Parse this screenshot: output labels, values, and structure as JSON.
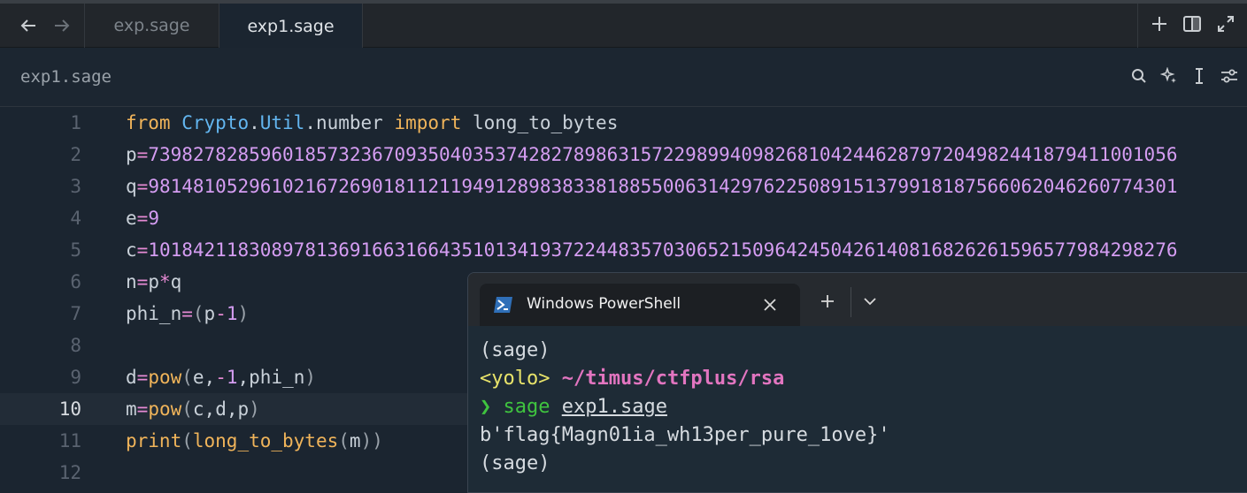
{
  "tabs": [
    {
      "label": "exp.sage"
    },
    {
      "label": "exp1.sage"
    }
  ],
  "breadcrumb": "exp1.sage",
  "icons": {
    "back": "arrow-left-icon",
    "forward": "arrow-right-icon",
    "new_tab": "plus-icon",
    "split": "split-pane-icon",
    "fullscreen": "maximize-icon",
    "search": "search-icon",
    "ai": "sparkle-icon",
    "cursor": "text-cursor-icon",
    "settings": "sliders-icon"
  },
  "code": {
    "current_line": 10,
    "lines": [
      {
        "n": "1"
      },
      {
        "n": "2",
        "p_value": "73982782859601857323670935040353742827898631572298994098268104244628797204982441879411001056"
      },
      {
        "n": "3",
        "q_value": "98148105296102167269018112119491289838338188550063142976225089151379918187566062046260774301"
      },
      {
        "n": "4",
        "e_value": "9"
      },
      {
        "n": "5",
        "c_value": "10184211830897813691663166435101341937224483570306521509642450426140816826261596577984298276"
      },
      {
        "n": "6"
      },
      {
        "n": "7"
      },
      {
        "n": "8"
      },
      {
        "n": "9"
      },
      {
        "n": "10"
      },
      {
        "n": "11"
      },
      {
        "n": "12"
      }
    ]
  },
  "terminal": {
    "tab_title": "Windows PowerShell",
    "lines": {
      "l1": "(sage)",
      "yolo": "<yolo>",
      "path": "~/timus/ctfplus/rsa",
      "prompt_char": "❯",
      "cmd": "sage",
      "arg": "exp1.sage",
      "output": "b'flag{Magn01ia_wh13per_pure_1ove}'",
      "l5": "(sage)"
    }
  }
}
